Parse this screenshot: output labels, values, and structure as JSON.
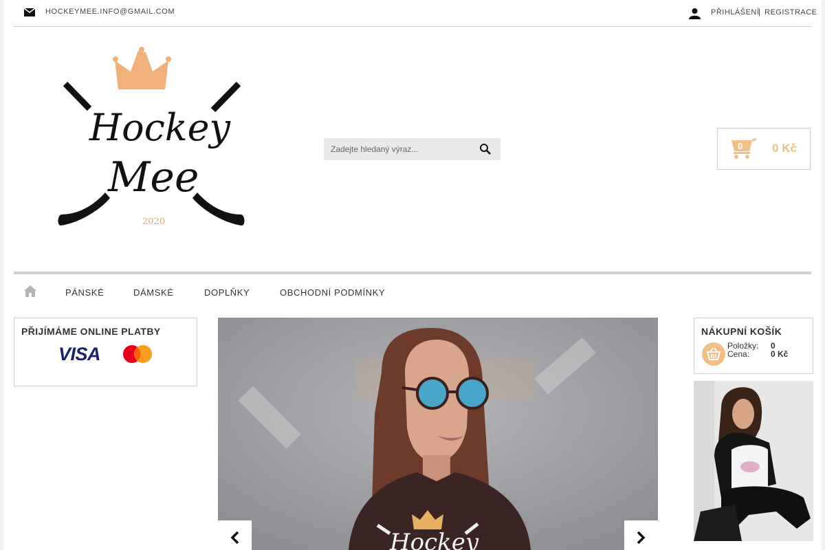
{
  "topbar": {
    "email": "HOCKEYMEE.INFO@GMAIL.COM",
    "login": "PŘIHLÁŠENÍ",
    "separator": "|",
    "register": "REGISTRACE"
  },
  "logo": {
    "text_line1": "Hockey",
    "text_line2": "Mee",
    "year": "2020"
  },
  "search": {
    "placeholder": "Zadejte hledaný výraz..."
  },
  "header_cart": {
    "count": "0",
    "price": "0 Kč"
  },
  "nav": {
    "items": [
      {
        "label": "PÁNSKÉ"
      },
      {
        "label": "DÁMSKÉ"
      },
      {
        "label": "DOPLŇKY"
      },
      {
        "label": "OBCHODNÍ PODMÍNKY"
      }
    ]
  },
  "payments": {
    "title": "PŘIJÍMÁME ONLINE PLATBY",
    "visa": "VISA"
  },
  "cart_widget": {
    "title": "NÁKUPNÍ KOŠÍK",
    "items_label": "Položky:",
    "items_value": "0",
    "price_label": "Cena:",
    "price_value": "0 Kč"
  },
  "slider": {
    "shirt_text": "Hockey"
  },
  "colors": {
    "accent": "#f2bf86",
    "border": "#cfcfcf",
    "visa_blue": "#1a1f71",
    "mastercard_red": "#eb001b",
    "mastercard_orange": "#f79e1b"
  }
}
